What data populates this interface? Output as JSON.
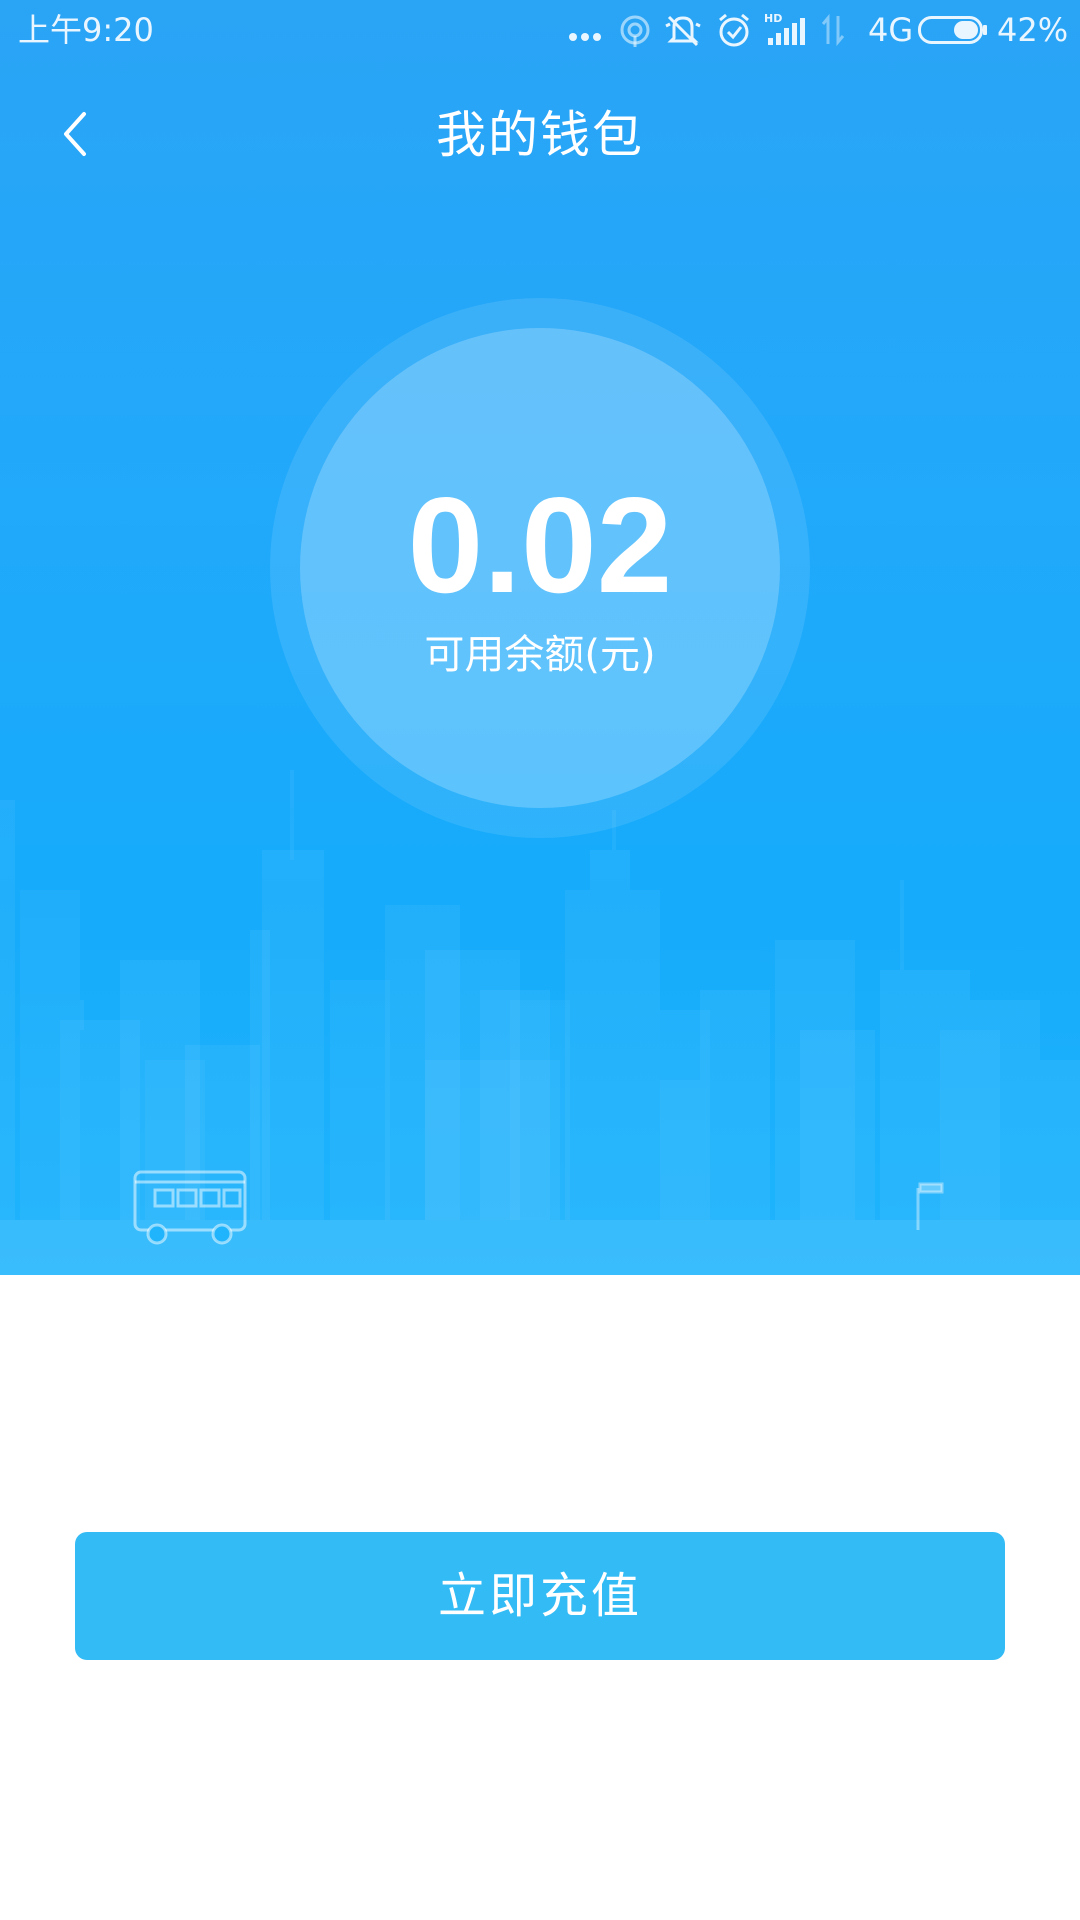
{
  "status_bar": {
    "time": "上午9:20",
    "network": "4G",
    "battery_percent": "42%",
    "battery_level": 0.42,
    "icons": [
      "more-dots-icon",
      "hotspot-icon",
      "mute-icon",
      "alarm-icon",
      "hd-signal-icon",
      "data-arrows-icon",
      "battery-icon"
    ]
  },
  "nav": {
    "title": "我的钱包",
    "back_icon": "chevron-left-icon"
  },
  "balance": {
    "amount": "0.02",
    "label": "可用余额(元)"
  },
  "actions": {
    "recharge_label": "立即充值"
  },
  "colors": {
    "hero_top": "#2aa4f5",
    "hero_bottom": "#1fb4fc",
    "button": "#33bbf5",
    "text": "#ffffff"
  }
}
